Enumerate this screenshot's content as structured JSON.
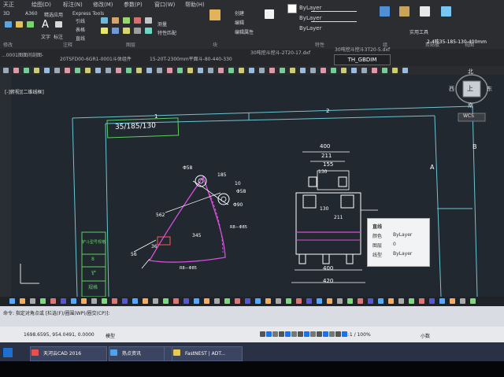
{
  "ribbon": {
    "menus": [
      "天正",
      "绘图(D)",
      "标注(N)",
      "修改(M)",
      "参数(P)",
      "窗口(W)",
      "帮助(H)",
      "Express Tools"
    ],
    "tabs": [
      "3D",
      "A360",
      "精选应用",
      "Express Tools"
    ],
    "group_labels": [
      "修改",
      "注释",
      "图层",
      "块",
      "特性",
      "组",
      "实用工具",
      "剪贴板",
      "视图"
    ],
    "bylayer_1": "ByLayer",
    "bylayer_2": "ByLayer",
    "bylayer_3": "ByLayer",
    "btn_create": "创建",
    "btn_edit": "编辑",
    "btn_edit_attr": "编辑属性",
    "btn_match": "特性匹配",
    "btn_measure": "测量",
    "btn_paste": "粘贴",
    "btn_base": "基点",
    "btn_text": "文字",
    "btn_dim": "标注",
    "text_table": "表格",
    "text_leader": "引线",
    "text_line": "直线"
  },
  "doc_tabs": [
    "...0001图面间剖图-",
    "20TSFD00-6GR1-0001斗体组件",
    "15-20T-2300mm平面斗-80-440-330",
    "30吨挖斗挖斗-2T20-17.dxf",
    "30吨挖斗挖斗3T20-5.dxf",
    "2-4吨35-185-130-400mm"
  ],
  "active_tab": "TH_GBDIM",
  "viewport_label": "[-]俯视][二维线框]",
  "drawing": {
    "frame_top_labels": [
      "1",
      "2"
    ],
    "frame_side_labels": [
      "A",
      "B"
    ],
    "title_block": "35/185/130",
    "dims_left": [
      "Φ58",
      "185",
      "10",
      "Φ58",
      "562",
      "345",
      "Φ90",
      "36",
      "56",
      "R8—Φ85",
      "R8—Φ85"
    ],
    "dims_right": [
      "400",
      "211",
      "155",
      "130",
      "211",
      "130",
      "400",
      "420"
    ],
    "table_labels": [
      "铲斗型号规格",
      "8",
      "铲",
      "规格"
    ]
  },
  "tooltip": {
    "title": "直线",
    "color_label": "颜色",
    "color_value": "ByLayer",
    "layer_label": "图层",
    "layer_value": "0",
    "linetype_label": "线型",
    "linetype_value": "ByLayer"
  },
  "navcube": {
    "north": "北",
    "south": "南",
    "east": "东",
    "west": "西",
    "face": "上",
    "wcs": "WCS"
  },
  "command": {
    "prompt": "命令: 指定对角点或 [栏选(F)/圈围(WP)/圈交(CP)]:",
    "input": ""
  },
  "status": {
    "coords": "1698.6595, 954.0491, 0.0000",
    "model": "模型",
    "scale": "1:1 / 100%",
    "units": "小数"
  },
  "taskbar": {
    "items": [
      "天河云CAD 2016",
      "热点资讯",
      "",
      "FastNEST | ADT..."
    ]
  },
  "colors": {
    "background": "#212830",
    "frame": "#6bc6d4",
    "dim": "#ffffff",
    "part": "#d64fd8",
    "accent": "#00a8ff",
    "green": "#5fcf61"
  }
}
